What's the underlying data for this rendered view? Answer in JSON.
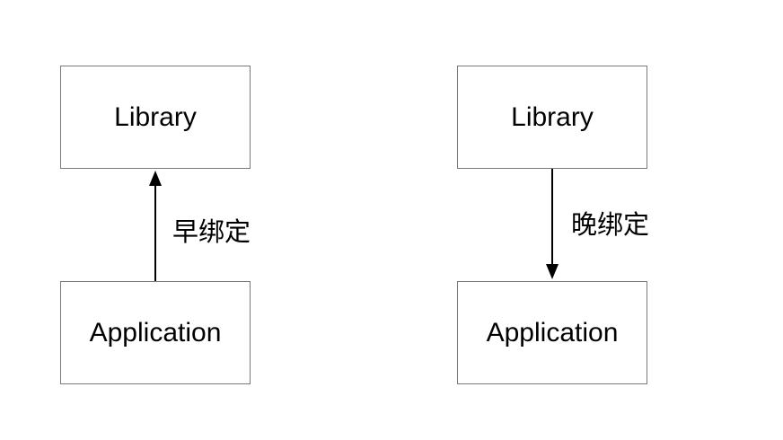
{
  "diagrams": [
    {
      "library_label": "Library",
      "application_label": "Application",
      "edge_label": "早绑定",
      "arrow_direction": "application-to-library"
    },
    {
      "library_label": "Library",
      "application_label": "Application",
      "edge_label": "晚绑定",
      "arrow_direction": "library-to-application"
    }
  ],
  "colors": {
    "box_border": "#7a7a7a",
    "arrow": "#000000",
    "text": "#000000",
    "background": "#ffffff"
  }
}
